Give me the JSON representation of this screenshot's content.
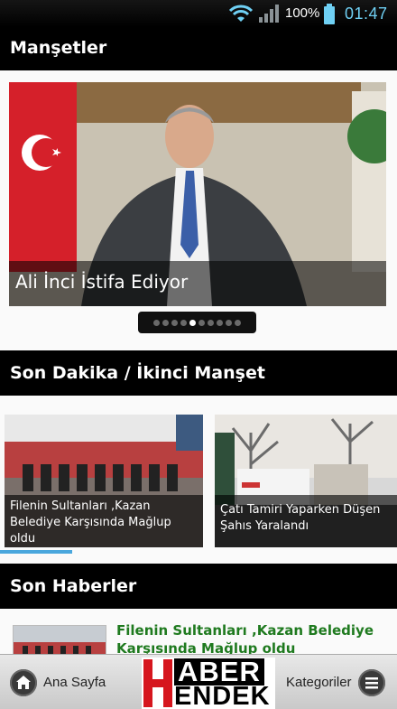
{
  "status_bar": {
    "battery_percent": "100%",
    "time": "01:47",
    "icons": [
      "wifi-icon",
      "signal-icon",
      "battery-icon"
    ]
  },
  "headlines": {
    "section_title": "Manşetler",
    "slide_title": "Ali İnci İstifa Ediyor",
    "page_count": 10,
    "active_index": 4
  },
  "breaking": {
    "section_title": "Son Dakika / İkinci Manşet",
    "cards": [
      {
        "caption": "Filenin Sultanları ,Kazan Belediye Karşısında Mağlup oldu"
      },
      {
        "caption": "Çatı Tamiri Yaparken Düşen Şahıs Yaralandı"
      }
    ]
  },
  "latest": {
    "section_title": "Son Haberler",
    "items": [
      {
        "title": "Filenin Sultanları ,Kazan Belediye Karşısında Mağlup oldu"
      }
    ]
  },
  "bottom_bar": {
    "home_label": "Ana Sayfa",
    "categories_label": "Kategoriler",
    "logo_line1": "ABER",
    "logo_line2": "ENDEK",
    "logo_letter": "H"
  },
  "colors": {
    "accent_time": "#6fd0f4",
    "news_title": "#1f7a1f",
    "logo_red": "#d6161e",
    "scroll_indicator": "#4aa7dd"
  }
}
